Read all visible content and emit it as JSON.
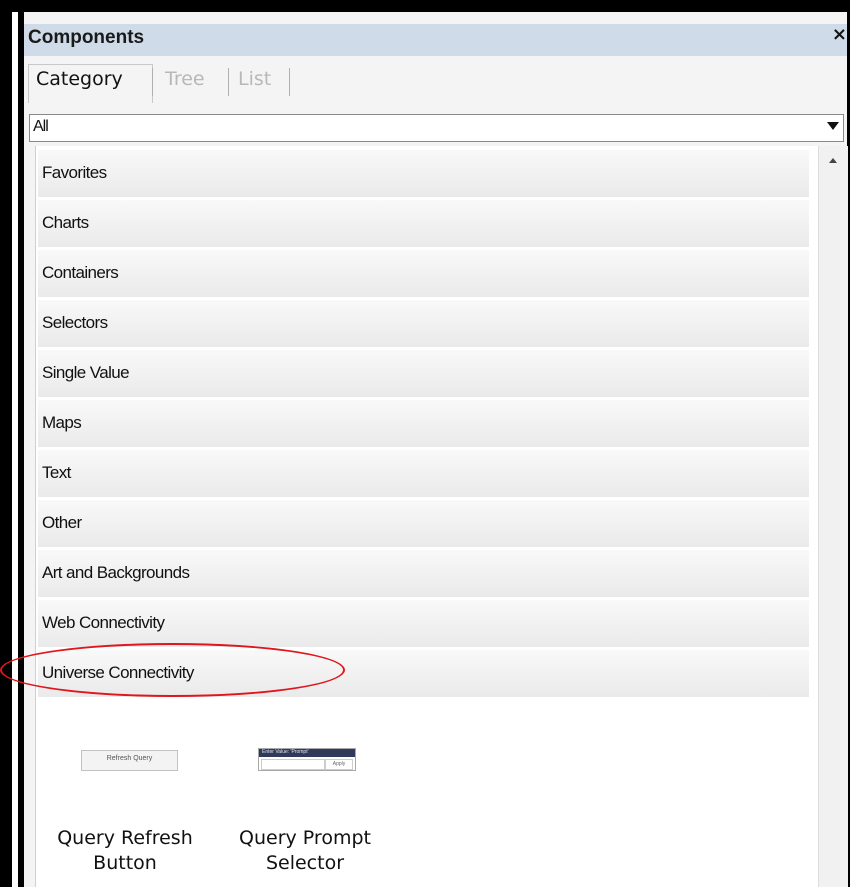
{
  "panel": {
    "title": "Components",
    "close_glyph": "×"
  },
  "tabs": [
    {
      "label": "Category",
      "active": true
    },
    {
      "label": "Tree",
      "active": false
    },
    {
      "label": "List",
      "active": false
    }
  ],
  "filter": {
    "selected": "All"
  },
  "categories": [
    {
      "label": "Favorites"
    },
    {
      "label": "Charts"
    },
    {
      "label": "Containers"
    },
    {
      "label": "Selectors"
    },
    {
      "label": "Single Value"
    },
    {
      "label": "Maps"
    },
    {
      "label": "Text"
    },
    {
      "label": "Other"
    },
    {
      "label": "Art and Backgrounds"
    },
    {
      "label": "Web Connectivity"
    },
    {
      "label": "Universe Connectivity",
      "highlighted": true
    }
  ],
  "components": [
    {
      "label_line1": "Query Refresh",
      "label_line2": "Button",
      "thumb_text": "Refresh Query",
      "icon": "query-refresh-thumbnail"
    },
    {
      "label_line1": "Query Prompt",
      "label_line2": "Selector",
      "thumb_header": "Enter Value: 'Prompt'",
      "thumb_button": "Apply",
      "icon": "query-prompt-thumbnail"
    }
  ],
  "colors": {
    "titlebar": "#cfdbe8",
    "highlight_ring": "#e0161d"
  }
}
